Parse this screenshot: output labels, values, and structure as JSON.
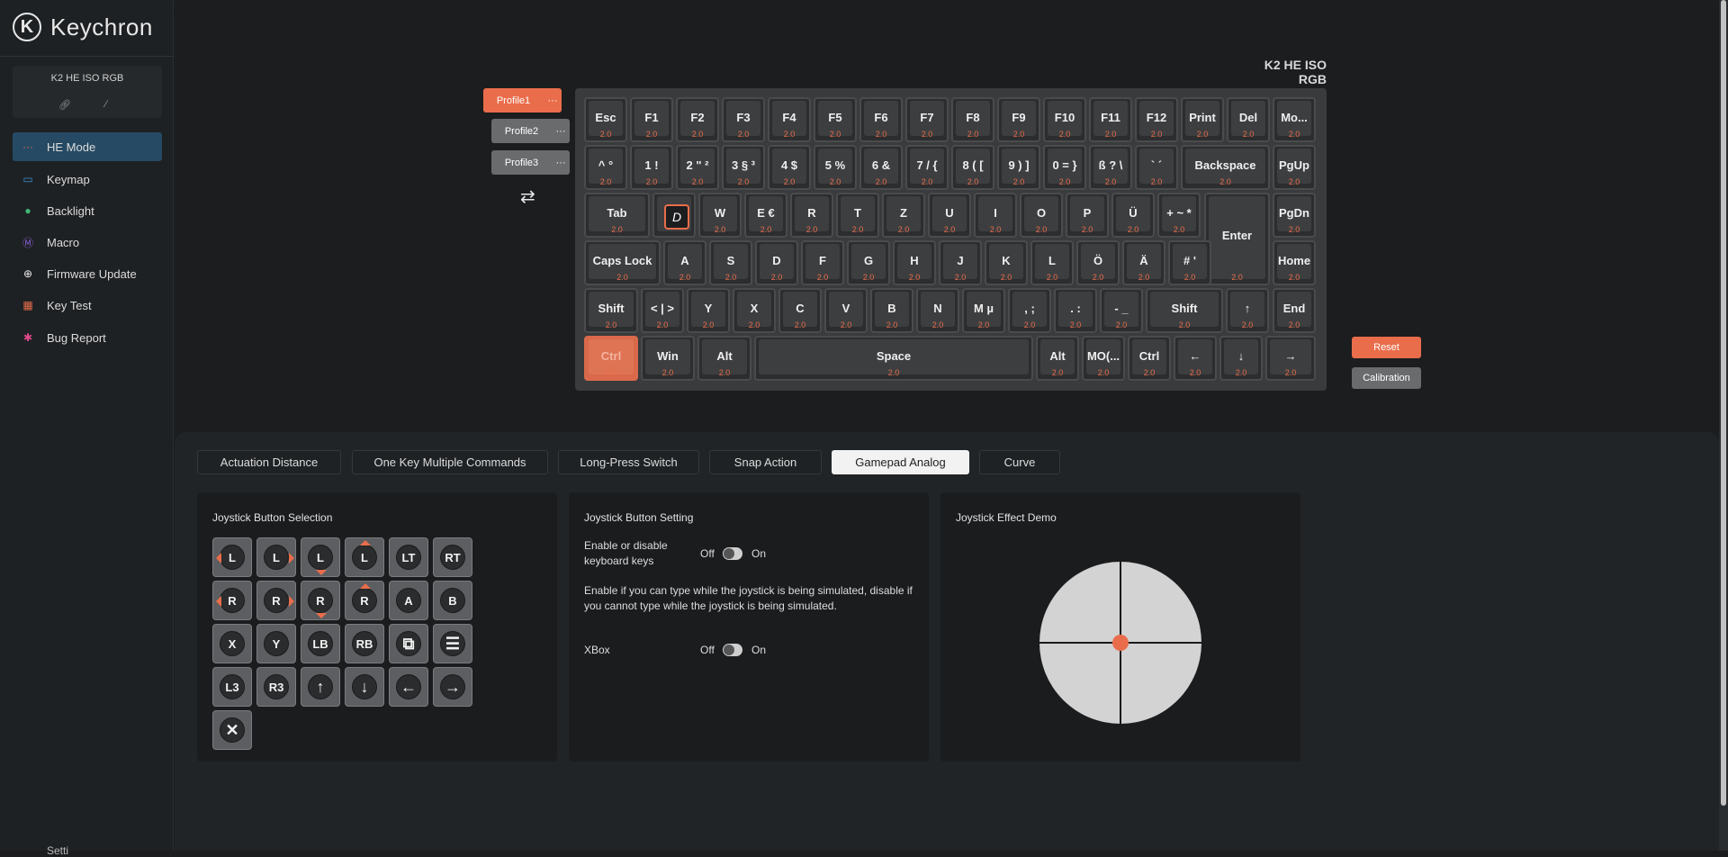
{
  "app": {
    "brand": "Keychron",
    "logo_letter": "K"
  },
  "device": {
    "name": "K2 HE ISO RGB",
    "link_icon": "link-icon",
    "unlink_icon": "unlink-icon"
  },
  "nav": [
    {
      "label": "HE Mode",
      "icon": "he-mode-icon",
      "active": true
    },
    {
      "label": "Keymap",
      "icon": "keymap-icon"
    },
    {
      "label": "Backlight",
      "icon": "bulb-icon"
    },
    {
      "label": "Macro",
      "icon": "macro-icon"
    },
    {
      "label": "Firmware Update",
      "icon": "firmware-icon"
    },
    {
      "label": "Key Test",
      "icon": "key-test-icon"
    },
    {
      "label": "Bug Report",
      "icon": "bug-icon"
    }
  ],
  "settings_peek": "Setti",
  "keyboard_title": "K2 HE ISO RGB",
  "profiles": [
    {
      "label": "Profile1",
      "menu": "···",
      "active": true
    },
    {
      "label": "Profile2",
      "menu": "···"
    },
    {
      "label": "Profile3",
      "menu": "···"
    }
  ],
  "keyboard": {
    "rows": [
      [
        [
          "Esc",
          "2.0"
        ],
        [
          "F1",
          "2.0"
        ],
        [
          "F2",
          "2.0"
        ],
        [
          "F3",
          "2.0"
        ],
        [
          "F4",
          "2.0"
        ],
        [
          "F5",
          "2.0"
        ],
        [
          "F6",
          "2.0"
        ],
        [
          "F7",
          "2.0"
        ],
        [
          "F8",
          "2.0"
        ],
        [
          "F9",
          "2.0"
        ],
        [
          "F10",
          "2.0"
        ],
        [
          "F11",
          "2.0"
        ],
        [
          "F12",
          "2.0"
        ],
        [
          "Print",
          "2.0"
        ],
        [
          "Del",
          "2.0"
        ],
        [
          "Mo...",
          "2.0"
        ]
      ],
      [
        [
          "^ °",
          "2.0"
        ],
        [
          "1 !",
          "2.0"
        ],
        [
          "2 \" ²",
          "2.0"
        ],
        [
          "3 § ³",
          "2.0"
        ],
        [
          "4 $",
          "2.0"
        ],
        [
          "5 %",
          "2.0"
        ],
        [
          "6 &",
          "2.0"
        ],
        [
          "7 / {",
          "2.0"
        ],
        [
          "8 ( [",
          "2.0"
        ],
        [
          "9 ) ]",
          "2.0"
        ],
        [
          "0 = }",
          "2.0"
        ],
        [
          "ß ? \\",
          "2.0"
        ],
        [
          "` ´",
          "2.0"
        ],
        [
          "Backspace",
          "2.0"
        ],
        [
          "PgUp",
          "2.0"
        ]
      ],
      [
        [
          "Tab",
          "2.0"
        ],
        [
          "D",
          ""
        ],
        [
          "W",
          "2.0"
        ],
        [
          "E €",
          "2.0"
        ],
        [
          "R",
          "2.0"
        ],
        [
          "T",
          "2.0"
        ],
        [
          "Z",
          "2.0"
        ],
        [
          "U",
          "2.0"
        ],
        [
          "I",
          "2.0"
        ],
        [
          "O",
          "2.0"
        ],
        [
          "P",
          "2.0"
        ],
        [
          "Ü",
          "2.0"
        ],
        [
          "+ ~ *",
          "2.0"
        ],
        [
          "Enter",
          "2.0"
        ],
        [
          "PgDn",
          "2.0"
        ]
      ],
      [
        [
          "Caps Lock",
          "2.0"
        ],
        [
          "A",
          "2.0"
        ],
        [
          "S",
          "2.0"
        ],
        [
          "D",
          "2.0"
        ],
        [
          "F",
          "2.0"
        ],
        [
          "G",
          "2.0"
        ],
        [
          "H",
          "2.0"
        ],
        [
          "J",
          "2.0"
        ],
        [
          "K",
          "2.0"
        ],
        [
          "L",
          "2.0"
        ],
        [
          "Ö",
          "2.0"
        ],
        [
          "Ä",
          "2.0"
        ],
        [
          "# '",
          "2.0"
        ],
        [
          "Home",
          "2.0"
        ]
      ],
      [
        [
          "Shift",
          "2.0"
        ],
        [
          "< | >",
          "2.0"
        ],
        [
          "Y",
          "2.0"
        ],
        [
          "X",
          "2.0"
        ],
        [
          "C",
          "2.0"
        ],
        [
          "V",
          "2.0"
        ],
        [
          "B",
          "2.0"
        ],
        [
          "N",
          "2.0"
        ],
        [
          "M µ",
          "2.0"
        ],
        [
          ", ;",
          "2.0"
        ],
        [
          ". :",
          "2.0"
        ],
        [
          "- _",
          "2.0"
        ],
        [
          "Shift",
          "2.0"
        ],
        [
          "↑",
          "2.0"
        ],
        [
          "End",
          "2.0"
        ]
      ],
      [
        [
          "Ctrl",
          "2.0"
        ],
        [
          "Win",
          "2.0"
        ],
        [
          "Alt",
          "2.0"
        ],
        [
          "Space",
          "2.0"
        ],
        [
          "Alt",
          "2.0"
        ],
        [
          "MO(...",
          "2.0"
        ],
        [
          "Ctrl",
          "2.0"
        ],
        [
          "←",
          "2.0"
        ],
        [
          "↓",
          "2.0"
        ],
        [
          "→",
          "2.0"
        ]
      ]
    ]
  },
  "actions": {
    "reset": "Reset",
    "calibration": "Calibration"
  },
  "tabs": [
    {
      "label": "Actuation Distance"
    },
    {
      "label": "One Key Multiple Commands"
    },
    {
      "label": "Long-Press Switch"
    },
    {
      "label": "Snap Action"
    },
    {
      "label": "Gamepad Analog",
      "active": true
    },
    {
      "label": "Curve"
    }
  ],
  "joystick_selection": {
    "title": "Joystick Button Selection",
    "buttons": [
      [
        "L",
        "L",
        "L",
        "L",
        "LT",
        "RT"
      ],
      [
        "R",
        "R",
        "R",
        "R",
        "A",
        "B"
      ],
      [
        "X",
        "Y",
        "LB",
        "RB",
        "view-icon",
        "menu-icon"
      ],
      [
        "L3",
        "R3",
        "arrow-up-icon",
        "arrow-down-icon",
        "arrow-left-icon",
        "arrow-right-icon"
      ],
      [
        "close-icon"
      ]
    ]
  },
  "joystick_setting": {
    "title": "Joystick Button Setting",
    "enable_label": "Enable or disable keyboard keys",
    "off": "Off",
    "on": "On",
    "description": "Enable if you can type while the joystick is being simulated, disable if you cannot type while the joystick is being simulated.",
    "xbox_label": "XBox"
  },
  "joystick_demo": {
    "title": "Joystick Effect Demo"
  },
  "colors": {
    "accent": "#E96D4A",
    "active_nav": "#264A63"
  }
}
